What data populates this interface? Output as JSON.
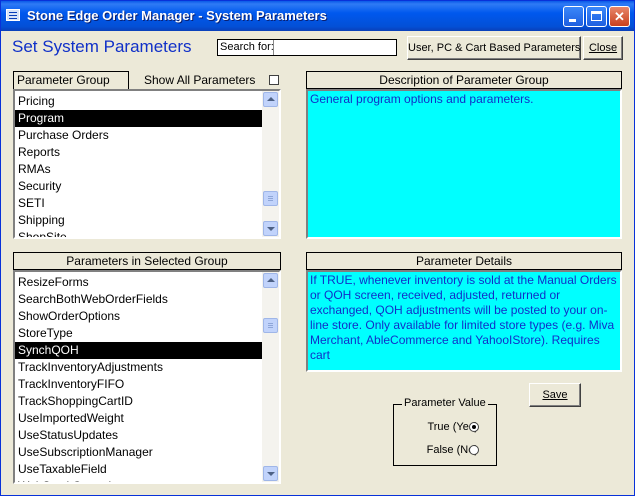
{
  "window": {
    "title": "Stone Edge Order Manager - System Parameters"
  },
  "header": {
    "heading": "Set System Parameters",
    "search_label": "Search for:",
    "search_value": "",
    "user_button": "User, PC & Cart Based Parameters",
    "close_button": "Close"
  },
  "parameter_group": {
    "tab_label": "Parameter Group",
    "show_all_label": "Show All Parameters",
    "show_all_checked": false,
    "items": [
      "Pricing",
      "Program",
      "Purchase Orders",
      "Reports",
      "RMAs",
      "Security",
      "SETI",
      "Shipping",
      "ShopSite"
    ],
    "selected": "Program"
  },
  "description": {
    "header": "Description of Parameter Group",
    "text": "General program options and parameters."
  },
  "parameters": {
    "header": "Parameters in Selected Group",
    "items": [
      "ResizeForms",
      "SearchBothWebOrderFields",
      "ShowOrderOptions",
      "StoreType",
      "SynchQOH",
      "TrackInventoryAdjustments",
      "TrackInventoryFIFO",
      "TrackShoppingCartID",
      "UseImportedWeight",
      "UseStatusUpdates",
      "UseSubscriptionManager",
      "UseTaxableField",
      "WebStockControl"
    ],
    "selected": "SynchQOH"
  },
  "details": {
    "header": "Parameter Details",
    "text": "If TRUE, whenever inventory is sold at the Manual Orders or QOH screen, received, adjusted, returned or exchanged, QOH adjustments will be posted to your on-line store. Only available for limited store types (e.g. Miva Merchant, AbleCommerce and YahooIStore). Requires cart"
  },
  "parameter_value": {
    "legend": "Parameter Value",
    "true_label": "True (Yes)",
    "false_label": "False (No)",
    "selected": "true"
  },
  "save_button": "Save",
  "colors": {
    "title_bar": "#0058ee",
    "heading": "#1030c8",
    "cyan_panel": "#00ffff",
    "selection": "#000000"
  }
}
